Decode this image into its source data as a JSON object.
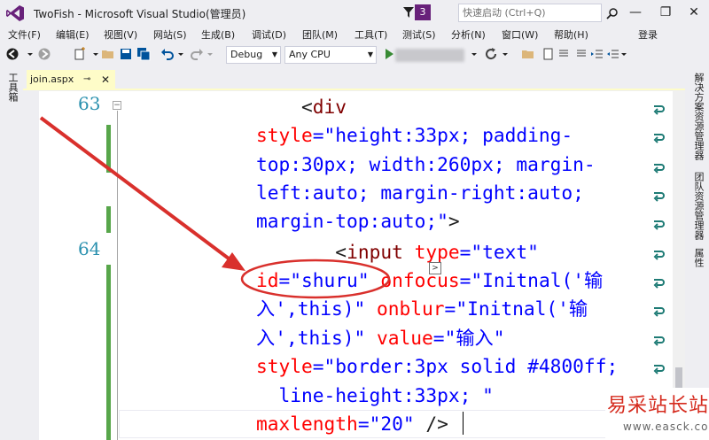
{
  "window": {
    "title": "TwoFish - Microsoft Visual Studio(管理员)",
    "notifications": "3",
    "quick_launch_placeholder": "快速启动 (Ctrl+Q)"
  },
  "menu": [
    "文件(F)",
    "编辑(E)",
    "视图(V)",
    "网站(S)",
    "生成(B)",
    "调试(D)",
    "团队(M)",
    "工具(T)",
    "测试(S)",
    "分析(N)",
    "窗口(W)",
    "帮助(H)"
  ],
  "login_label": "登录",
  "toolbar": {
    "configuration": "Debug",
    "platform": "Any CPU"
  },
  "left_tab": "工具箱",
  "document_tab": {
    "name": "join.aspx"
  },
  "editor": {
    "line_numbers": [
      "63",
      "64"
    ],
    "lines": [
      [
        {
          "t": "    <",
          "c": "c-plain"
        },
        {
          "t": "div",
          "c": "c-tag"
        }
      ],
      [
        {
          "t": "style",
          "c": "c-attr"
        },
        {
          "t": "=",
          "c": "c-val"
        },
        {
          "t": "\"height:33px; padding-",
          "c": "c-val"
        }
      ],
      [
        {
          "t": "top:30px; width:260px; margin-",
          "c": "c-val"
        }
      ],
      [
        {
          "t": "left:auto; margin-right:auto;",
          "c": "c-val"
        }
      ],
      [
        {
          "t": "margin-top:auto;\"",
          "c": "c-val"
        },
        {
          "t": ">",
          "c": "c-plain"
        }
      ],
      [
        {
          "t": "       <",
          "c": "c-plain"
        },
        {
          "t": "input",
          "c": "c-tag"
        },
        {
          "t": " type",
          "c": "c-attr"
        },
        {
          "t": "=",
          "c": "c-val"
        },
        {
          "t": "\"text\"",
          "c": "c-val"
        }
      ],
      [
        {
          "t": "id",
          "c": "c-attr"
        },
        {
          "t": "=",
          "c": "c-val"
        },
        {
          "t": "\"shuru\"",
          "c": "c-val"
        },
        {
          "t": " onfocus",
          "c": "c-attr"
        },
        {
          "t": "=",
          "c": "c-val"
        },
        {
          "t": "\"Initnal('输",
          "c": "c-val"
        }
      ],
      [
        {
          "t": "入',this)\"",
          "c": "c-val"
        },
        {
          "t": " onblur",
          "c": "c-attr"
        },
        {
          "t": "=",
          "c": "c-val"
        },
        {
          "t": "\"Initnal('输",
          "c": "c-val"
        }
      ],
      [
        {
          "t": "入',this)\"",
          "c": "c-val"
        },
        {
          "t": " value",
          "c": "c-attr"
        },
        {
          "t": "=",
          "c": "c-val"
        },
        {
          "t": "\"输入\"",
          "c": "c-val"
        }
      ],
      [
        {
          "t": "style",
          "c": "c-attr"
        },
        {
          "t": "=",
          "c": "c-val"
        },
        {
          "t": "\"border:3px solid #4800ff;",
          "c": "c-val"
        }
      ],
      [
        {
          "t": "  line-height:33px; \"",
          "c": "c-val"
        }
      ],
      [
        {
          "t": "maxlength",
          "c": "c-attr"
        },
        {
          "t": "=",
          "c": "c-val"
        },
        {
          "t": "\"20\"",
          "c": "c-val"
        },
        {
          "t": " />",
          "c": "c-plain"
        }
      ]
    ]
  },
  "right_tabs": [
    "解决方案资源管理器",
    "团队资源管理器",
    "属性"
  ],
  "watermark": {
    "name": "易采站长站",
    "url": "www.easck.com"
  },
  "colors": {
    "accent": "#68217a",
    "annotation": "#d9302c",
    "active_tab": "#fefcc8"
  }
}
